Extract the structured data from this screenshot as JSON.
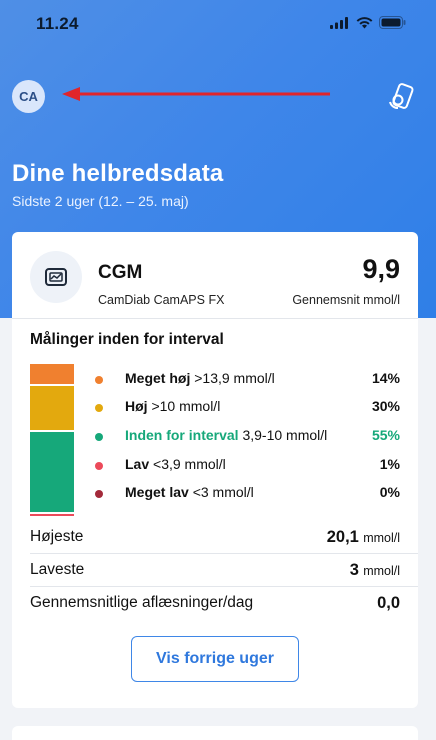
{
  "status_bar": {
    "time": "11.24"
  },
  "header": {
    "avatar_initials": "CA",
    "title": "Dine helbredsdata",
    "subtitle": "Sidste 2 uger (12. – 25. maj)"
  },
  "cgm": {
    "name": "CGM",
    "device": "CamDiab CamAPS FX",
    "average_value": "9,9",
    "average_label": "Gennemsnit mmol/l"
  },
  "range": {
    "title": "Målinger inden for interval",
    "items": [
      {
        "bold": "Meget høj",
        "rest": " >13,9 mmol/l",
        "pct": "14%",
        "color": "#f0802f",
        "fraction": 0.14
      },
      {
        "bold": "Høj",
        "rest": " >10 mmol/l",
        "pct": "30%",
        "color": "#e3a90e",
        "fraction": 0.3
      },
      {
        "bold": "Inden for interval",
        "rest": " 3,9-10 mmol/l",
        "pct": "55%",
        "color": "#16a87a",
        "fraction": 0.55
      },
      {
        "bold": "Lav",
        "rest": " <3,9 mmol/l",
        "pct": "1%",
        "color": "#ec4a5a",
        "fraction": 0.01
      },
      {
        "bold": "Meget lav",
        "rest": " <3 mmol/l",
        "pct": "0%",
        "color": "#a32a3a",
        "fraction": 0.0
      }
    ]
  },
  "stats": {
    "highest_label": "Højeste",
    "highest_value": "20,1",
    "highest_unit": "mmol/l",
    "lowest_label": "Laveste",
    "lowest_value": "3",
    "lowest_unit": "mmol/l",
    "avg_readings_label": "Gennemsnitlige aflæsninger/dag",
    "avg_readings_value": "0,0"
  },
  "button": {
    "label": "Vis forrige uger"
  },
  "colors": {
    "accent": "#3f87e7",
    "in_range_text": "#16a87a",
    "arrow": "#e0252b"
  },
  "icons": {
    "device_sync": "device-sync-icon",
    "cgm_sensor": "cgm-sensor-icon"
  }
}
